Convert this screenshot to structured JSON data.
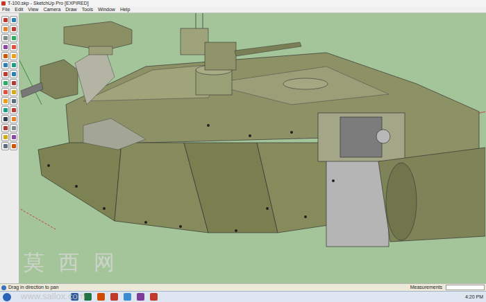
{
  "window": {
    "title": "T-100.skp - SketchUp Pro [EXPIRED]"
  },
  "menu": [
    "File",
    "Edit",
    "View",
    "Camera",
    "Draw",
    "Tools",
    "Window",
    "Help"
  ],
  "status_bar": {
    "hint": "Drag in direction to pan",
    "measurements_label": "Measurements"
  },
  "watermark": {
    "title": "莫 西 网",
    "url": "www.sallox.com"
  },
  "taskbar": {
    "time": "4:20 PM"
  }
}
